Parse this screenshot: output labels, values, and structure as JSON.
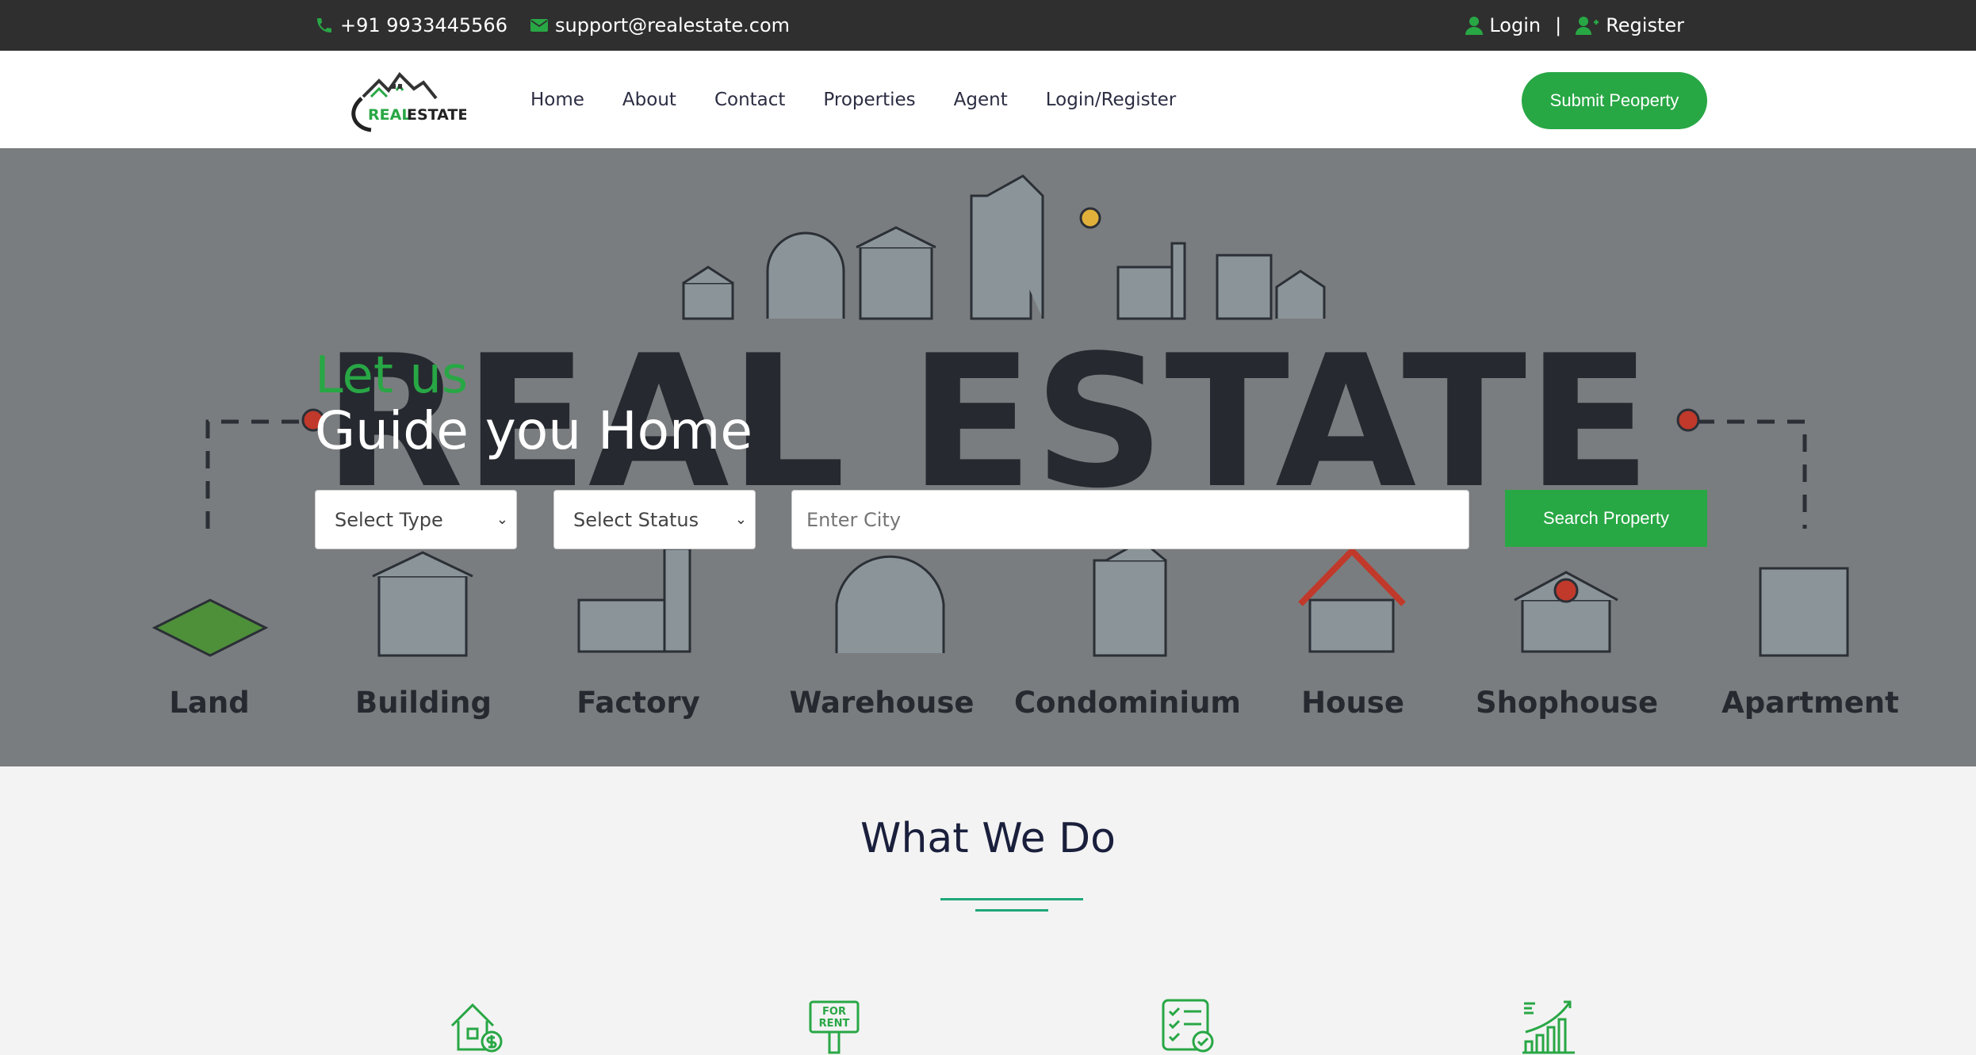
{
  "topbar": {
    "phone": "+91 9933445566",
    "email": "support@realestate.com",
    "login": "Login",
    "separator": "|",
    "register": "Register"
  },
  "nav": {
    "logo_text_real": "REAL",
    "logo_text_estate": "ESTATE",
    "items": [
      "Home",
      "About",
      "Contact",
      "Properties",
      "Agent",
      "Login/Register"
    ],
    "submit_label": "Submit Peoperty"
  },
  "hero": {
    "tagline_small": "Let us",
    "tagline_big": "Guide you Home",
    "banner_word": "REAL ESTATE",
    "categories": [
      "Land",
      "Building",
      "Factory",
      "Warehouse",
      "Condominium",
      "House",
      "Shophouse",
      "Apartment"
    ],
    "search": {
      "type_value": "Select Type",
      "status_value": "Select Status",
      "city_placeholder": "Enter City",
      "button_label": "Search Property"
    }
  },
  "section": {
    "what_title": "What We Do",
    "service_icons": [
      "house-dollar-icon",
      "for-rent-sign-icon",
      "checklist-icon",
      "growth-chart-icon"
    ],
    "for_rent_line1": "FOR",
    "for_rent_line2": "RENT"
  },
  "colors": {
    "accent": "#28a745",
    "topbar": "#2f2f2f",
    "hero_overlay": "#7a7d7f",
    "heading": "#1a1f3c"
  }
}
